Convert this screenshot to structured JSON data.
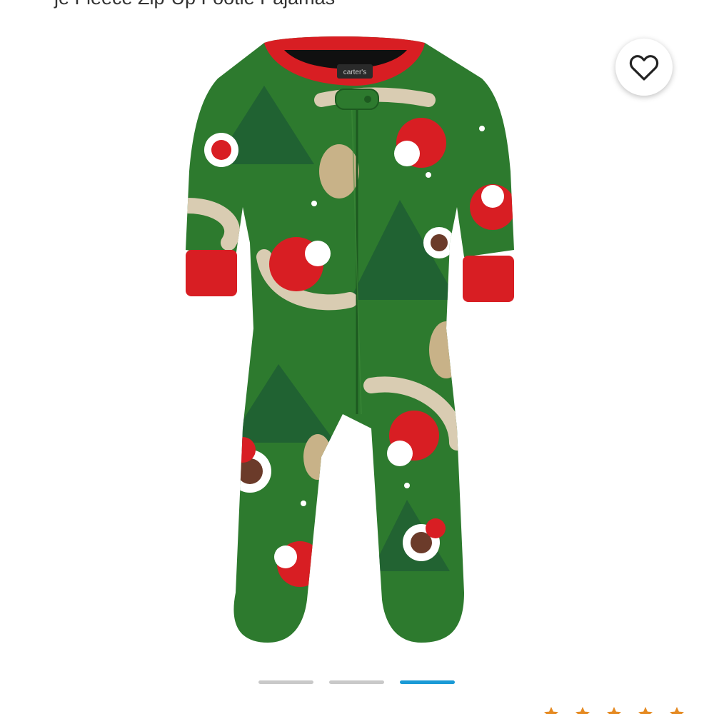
{
  "product": {
    "title_partial": "je Fleece Zip-Up Footie Pajamas",
    "image_alt": "Baby Santa Fleece Zip-Up Footie Pajamas",
    "label_text": "carter's",
    "colors": {
      "body": "#2d7a2e",
      "trim": "#d81e23"
    }
  },
  "favorite": {
    "icon": "heart-outline-icon",
    "aria_label": "Add to favorites"
  },
  "carousel": {
    "total": 3,
    "active_index": 2,
    "colors": {
      "inactive": "#c9c9c9",
      "active": "#1a9ad6"
    }
  },
  "rating": {
    "icon": "star-icon",
    "color": "#e58a22"
  }
}
